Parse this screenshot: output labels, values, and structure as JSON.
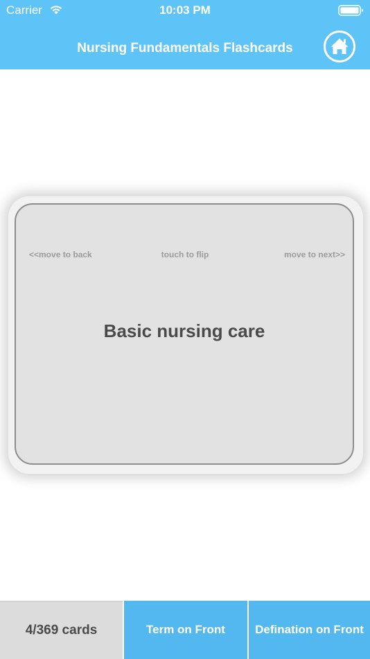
{
  "status_bar": {
    "carrier": "Carrier",
    "time": "10:03 PM",
    "wifi_icon": "wifi-icon",
    "battery_icon": "battery-icon"
  },
  "nav": {
    "title": "Nursing Fundamentals Flashcards",
    "home_icon": "home-icon"
  },
  "card": {
    "term": "Basic nursing care",
    "hint_back": "<<move to back",
    "hint_flip": "touch to flip",
    "hint_next": "move to next>>"
  },
  "bottom": {
    "count": "4/369 cards",
    "term_on_front": "Term on Front",
    "definition_on_front": "Defination on Front"
  },
  "colors": {
    "accent": "#5ec4f7",
    "tab_button": "#52b8ef",
    "card_fill": "#e2e2e2",
    "count_fill": "#dcdcdc"
  }
}
